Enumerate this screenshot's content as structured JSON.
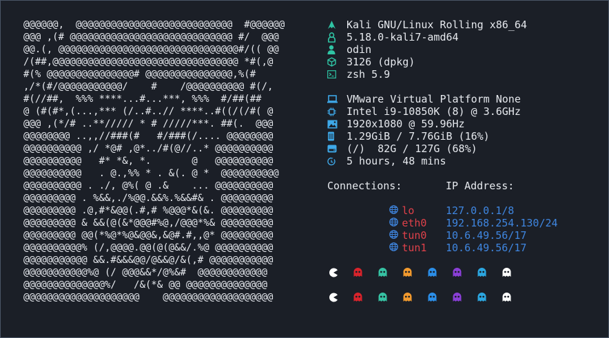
{
  "ascii_art": "@@@@@@,  @@@@@@@@@@@@@@@@@@@@@@@@@@@  #@@@@@@\n@@@ ,(# @@@@@@@@@@@@@@@@@@@@@@@@@@@@ #/  @@@\n@@.(, @@@@@@@@@@@@@@@@@@@@@@@@@@@@@@@#/(( @@\n/(##,@@@@@@@@@@@@@@@@@@@@@@@@@@@@@@@@ *#(,@\n#(% @@@@@@@@@@@@@@@# @@@@@@@@@@@@@@@,%(#\n,/*(#/@@@@@@@@@@@/    #    /@@@@@@@@@@ #(/,\n#(//##,  %%% ****...#...***, %%%  #/##(##\n@ (#(#*,(...,*** (/..#..// ****..#((/(/#( @\n@@@ ,(*/# ..**///// * # /////***. ##(.  @@@\n@@@@@@@@ ..,,//###(#   #/###(/.... @@@@@@@@\n@@@@@@@@@@ ,/ *@# ,@*../#(@//..* @@@@@@@@@@\n@@@@@@@@@@   #* *&, *.       @   @@@@@@@@@@\n@@@@@@@@@@   . @.,%% * . &(. @ *  @@@@@@@@@@\n@@@@@@@@@@ . ./, @%( @ .&    ... @@@@@@@@@@\n@@@@@@@@@ . %&&,./%@@.&&%.%&&#& . @@@@@@@@@\n@@@@@@@@@ .@,#*&@@(.#,# %@@@*&(&. @@@@@@@@@\n@@@@@@@@@ & &&(@(&*@@@#%@,/@@@*%& @@@@@@@@@\n@@@@@@@@@ @@(*%@*%@&@@&,&@#.#,,@* @@@@@@@@@\n@@@@@@@@@@% (/,@@@@.@@(@(@&&/.%@ @@@@@@@@@@\n@@@@@@@@@@@ &&.#&&&@@/@&&@/&(,# @@@@@@@@@@@\n@@@@@@@@@@@%@ (/ @@@&&*/@%&#  @@@@@@@@@@@@\n@@@@@@@@@@@@@@%/   /&(*& @@ @@@@@@@@@@@@@@\n@@@@@@@@@@@@@@@@@@@@    @@@@@@@@@@@@@@@@@@@",
  "info": {
    "os": "Kali GNU/Linux Rolling x86_64",
    "kernel": "5.18.0-kali7-amd64",
    "user": "odin",
    "packages": "3126 (dpkg)",
    "shell": "zsh 5.9",
    "host": "VMware Virtual Platform None",
    "cpu": "Intel i9-10850K (8) @ 3.6GHz",
    "resolution": "1920x1080 @ 59.96Hz",
    "memory": "1.29GiB / 7.76GiB (16%)",
    "disk": "(/)  82G / 127G (68%)",
    "uptime": "5 hours, 48 mins"
  },
  "connections": {
    "header_left": "Connections:",
    "header_right": "IP Address:",
    "rows": [
      {
        "iface": "lo",
        "ip": "127.0.0.1/8"
      },
      {
        "iface": "eth0",
        "ip": "192.168.254.130/24"
      },
      {
        "iface": "tun0",
        "ip": "10.6.49.56/17"
      },
      {
        "iface": "tun1",
        "ip": "10.6.49.56/17"
      }
    ]
  },
  "icons": {
    "os": "kali-dragon-icon",
    "kernel": "linux-penguin-icon",
    "user": "user-icon",
    "packages": "package-icon",
    "shell": "terminal-icon",
    "host": "laptop-icon",
    "cpu": "cpu-icon",
    "resolution": "monitor-image-icon",
    "memory": "memory-icon",
    "disk": "disk-icon",
    "uptime": "clock-icon",
    "iface": "globe-icon"
  },
  "colors": {
    "icon_accent": "#3ea8e8",
    "interface_red": "#e0414a",
    "ip_blue": "#3f86e0",
    "globe_blue": "#3f86e0",
    "kali_green": "#2fc4a4"
  },
  "palette_rows": [
    [
      "#ffffff",
      "#d9232b",
      "#36c2a3",
      "#f29a2e",
      "#2b8ee8",
      "#8a3fd6",
      "#2ba6e0",
      "#ffffff"
    ],
    [
      "#ffffff",
      "#d9232b",
      "#36c2a3",
      "#f29a2e",
      "#2b8ee8",
      "#8a3fd6",
      "#2ba6e0",
      "#ffffff"
    ]
  ]
}
